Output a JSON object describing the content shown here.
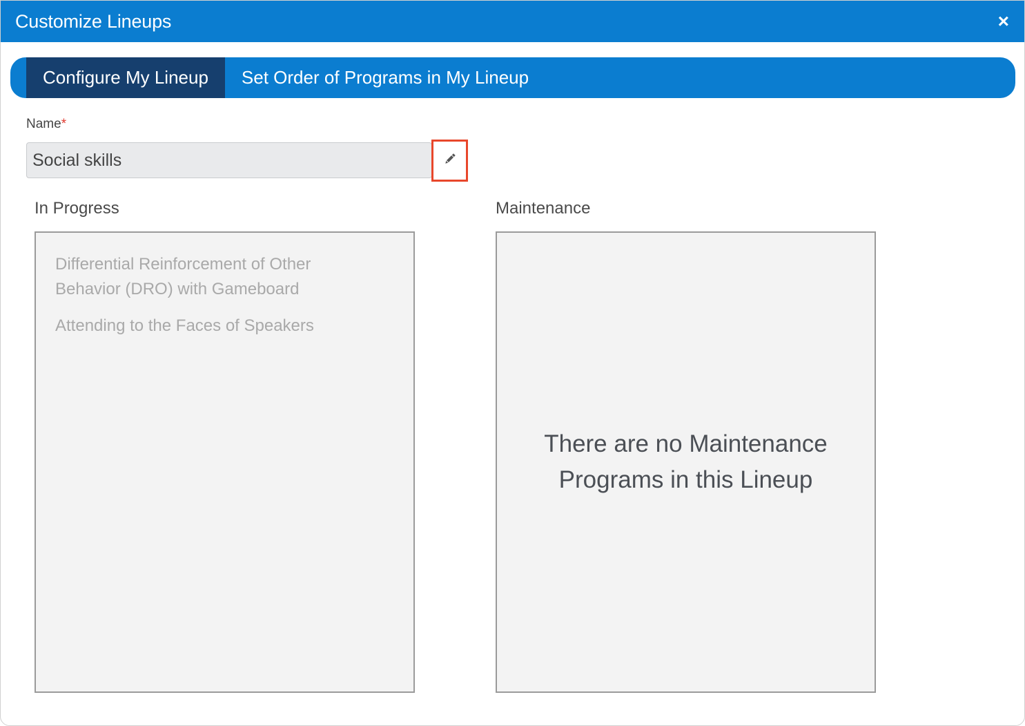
{
  "window": {
    "title": "Customize Lineups",
    "close_label": "×"
  },
  "tabs": [
    {
      "label": "Configure My Lineup",
      "active": true
    },
    {
      "label": "Set Order of Programs in My Lineup",
      "active": false
    }
  ],
  "form": {
    "name_label": "Name",
    "required_mark": "*",
    "name_value": "Social skills",
    "edit_icon": "pencil-icon"
  },
  "in_progress": {
    "label": "In Progress",
    "items": [
      "Differential Reinforcement of Other Behavior (DRO) with Gameboard",
      "Attending to the Faces of Speakers"
    ]
  },
  "maintenance": {
    "label": "Maintenance",
    "empty_message": "There are no Maintenance Programs in this Lineup"
  },
  "colors": {
    "accent": "#0b7dd0",
    "active_tab": "#163f6e",
    "highlight_border": "#e8472b"
  }
}
